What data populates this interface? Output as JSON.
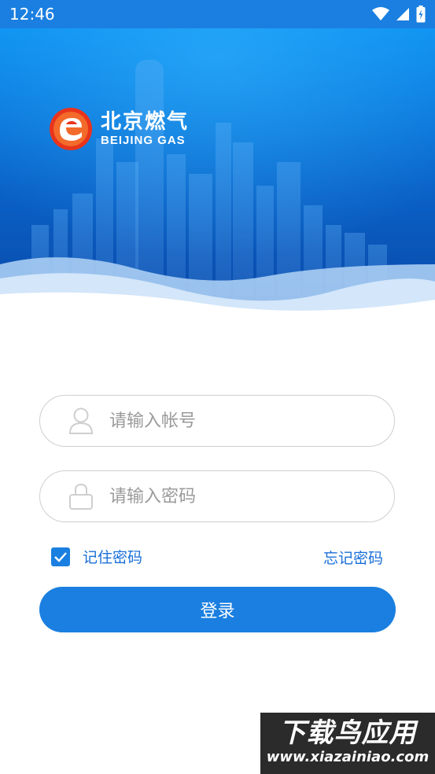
{
  "status_bar": {
    "time": "12:46",
    "icons": [
      "wifi-icon",
      "signal-icon",
      "battery-icon"
    ]
  },
  "brand": {
    "name_cn": "北京燃气",
    "name_en": "BEIJING GAS",
    "colors": {
      "logo_red": "#e8341c",
      "primary": "#1a7fe0"
    }
  },
  "login_form": {
    "username_placeholder": "请输入帐号",
    "password_placeholder": "请输入密码",
    "remember_label": "记住密码",
    "remember_checked": true,
    "forgot_label": "忘记密码",
    "submit_label": "登录"
  },
  "watermark": {
    "title": "下载鸟应用",
    "url": "www.xiazainiao.com"
  }
}
